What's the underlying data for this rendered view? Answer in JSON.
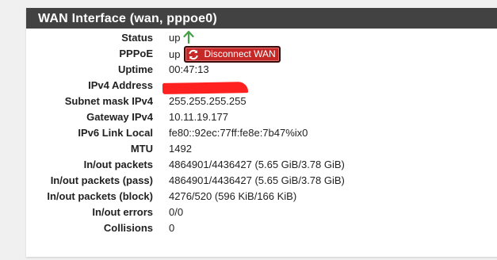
{
  "panel": {
    "title": "WAN Interface (wan, pppoe0)"
  },
  "colors": {
    "heading_bg": "#424242",
    "up_arrow": "#43a047",
    "danger_button": "#c62828",
    "redaction": "#ff2020"
  },
  "rows": {
    "status": {
      "label": "Status",
      "value": "up",
      "icon": "arrow-up-icon"
    },
    "pppoe": {
      "label": "PPPoE",
      "value": "up",
      "button_label": "Disconnect WAN",
      "button_icon": "refresh-icon"
    },
    "uptime": {
      "label": "Uptime",
      "value": "00:47:13"
    },
    "ipv4_address": {
      "label": "IPv4 Address",
      "value": ""
    },
    "subnet_mask_ipv4": {
      "label": "Subnet mask IPv4",
      "value": "255.255.255.255"
    },
    "gateway_ipv4": {
      "label": "Gateway IPv4",
      "value": "10.11.19.177"
    },
    "ipv6_link_local": {
      "label": "IPv6 Link Local",
      "value": "fe80::92ec:77ff:fe8e:7b47%ix0"
    },
    "mtu": {
      "label": "MTU",
      "value": "1492"
    },
    "inout_packets": {
      "label": "In/out packets",
      "value": "4864901/4436427 (5.65 GiB/3.78 GiB)"
    },
    "inout_packets_pass": {
      "label": "In/out packets (pass)",
      "value": "4864901/4436427 (5.65 GiB/3.78 GiB)"
    },
    "inout_packets_block": {
      "label": "In/out packets (block)",
      "value": "4276/520 (596 KiB/166 KiB)"
    },
    "inout_errors": {
      "label": "In/out errors",
      "value": "0/0"
    },
    "collisions": {
      "label": "Collisions",
      "value": "0"
    }
  }
}
